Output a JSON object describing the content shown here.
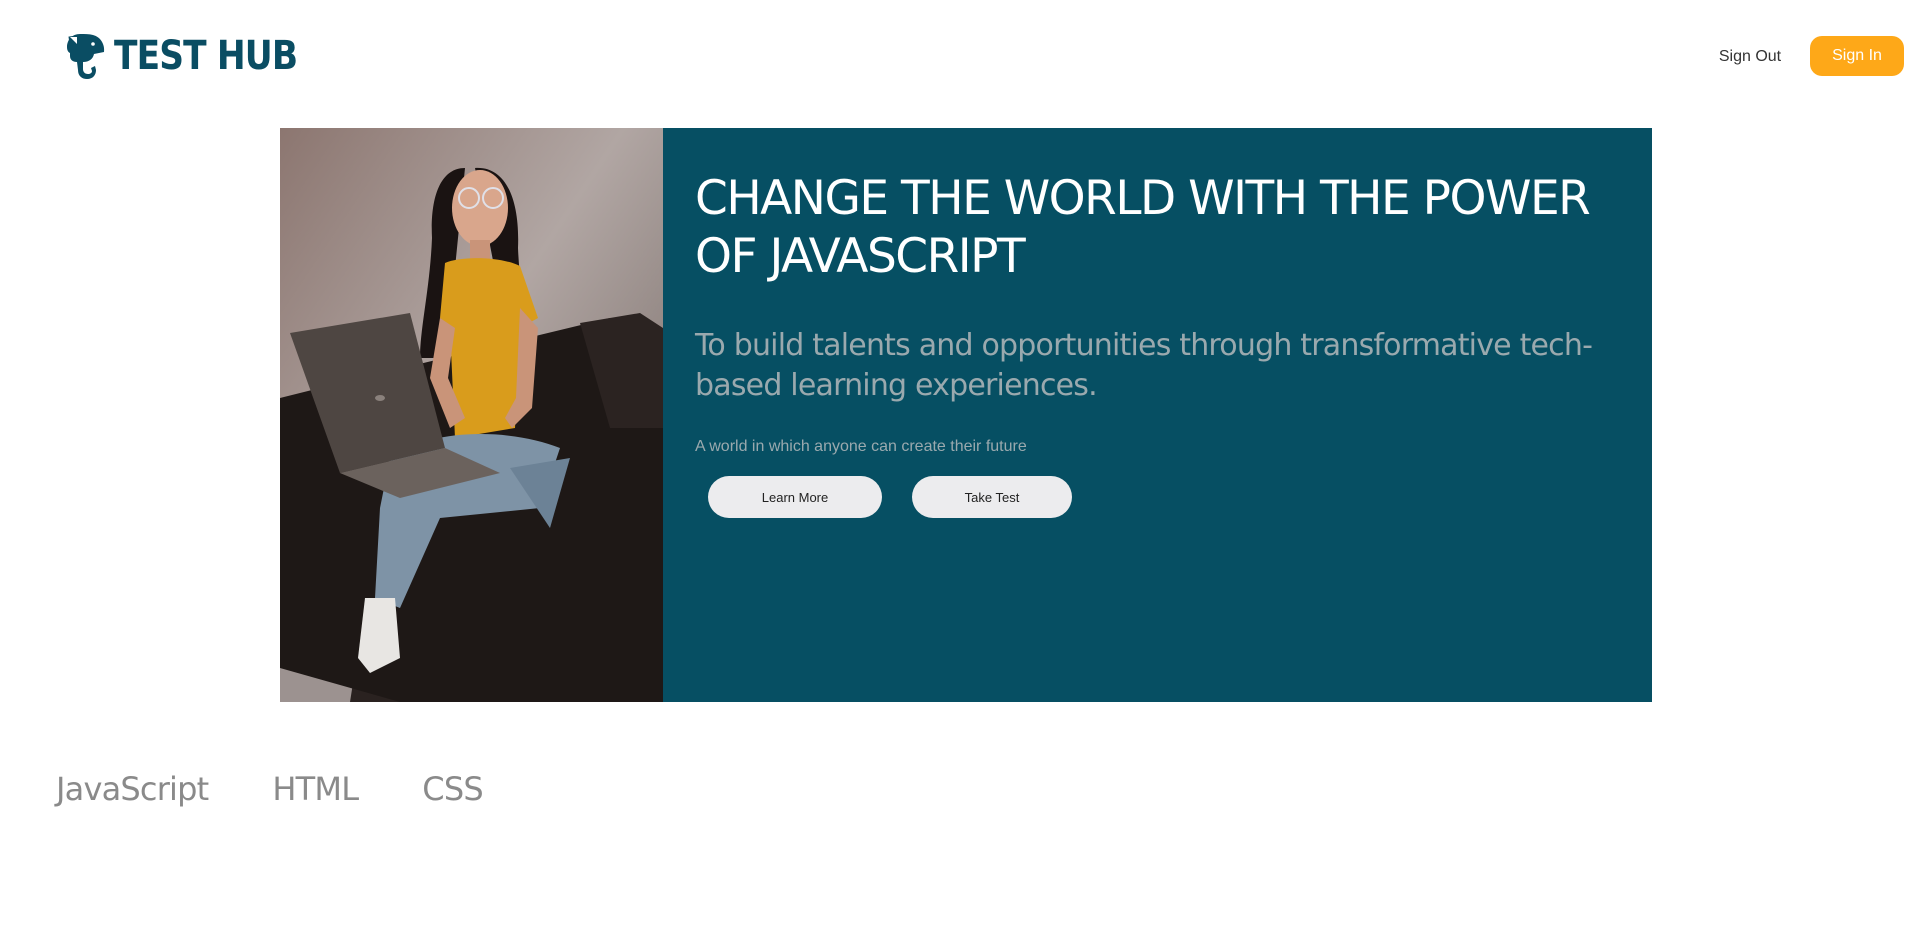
{
  "header": {
    "brand_name": "TEST HUB",
    "brand_icon": "elephant-icon",
    "sign_out_label": "Sign Out",
    "sign_in_label": "Sign In"
  },
  "hero": {
    "photo": "woman-with-laptop-photo",
    "title": "CHANGE THE WORLD WITH THE POWER OF JAVASCRIPT",
    "subtitle": "To build talents and opportunities through transformative tech-based learning experiences.",
    "tagline": "A world in which anyone can create their future",
    "learn_more_label": "Learn More",
    "take_test_label": "Take Test"
  },
  "topics": [
    {
      "label": "JavaScript"
    },
    {
      "label": "HTML"
    },
    {
      "label": "CSS"
    }
  ],
  "colors": {
    "brand": "#0a4d63",
    "hero_panel": "#064f63",
    "accent": "#fea818",
    "muted_text": "#9aa9ae",
    "topic_text": "#8a8a8a"
  }
}
